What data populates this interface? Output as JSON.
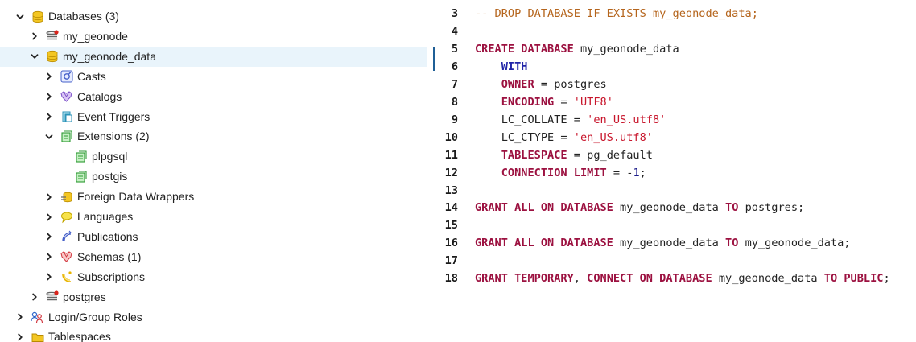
{
  "tree": {
    "items": [
      {
        "label": "Databases (3)",
        "chevron": "down",
        "icon": "database-icon",
        "level": 0
      },
      {
        "label": "my_geonode",
        "chevron": "right",
        "icon": "database-disconnected-icon",
        "level": 1
      },
      {
        "label": "my_geonode_data",
        "chevron": "down",
        "icon": "database-icon",
        "level": 1,
        "selected": true
      },
      {
        "label": "Casts",
        "chevron": "right",
        "icon": "casts-icon",
        "level": 2
      },
      {
        "label": "Catalogs",
        "chevron": "right",
        "icon": "catalogs-icon",
        "level": 2
      },
      {
        "label": "Event Triggers",
        "chevron": "right",
        "icon": "event-triggers-icon",
        "level": 2
      },
      {
        "label": "Extensions (2)",
        "chevron": "down",
        "icon": "extensions-icon",
        "level": 2
      },
      {
        "label": "plpgsql",
        "chevron": "none",
        "icon": "extension-icon",
        "level": 3
      },
      {
        "label": "postgis",
        "chevron": "none",
        "icon": "extension-icon",
        "level": 3
      },
      {
        "label": "Foreign Data Wrappers",
        "chevron": "right",
        "icon": "foreign-data-wrappers-icon",
        "level": 2
      },
      {
        "label": "Languages",
        "chevron": "right",
        "icon": "languages-icon",
        "level": 2
      },
      {
        "label": "Publications",
        "chevron": "right",
        "icon": "publications-icon",
        "level": 2
      },
      {
        "label": "Schemas (1)",
        "chevron": "right",
        "icon": "schemas-icon",
        "level": 2
      },
      {
        "label": "Subscriptions",
        "chevron": "right",
        "icon": "subscriptions-icon",
        "level": 2
      },
      {
        "label": "postgres",
        "chevron": "right",
        "icon": "database-disconnected-icon",
        "level": 1
      },
      {
        "label": "Login/Group Roles",
        "chevron": "right",
        "icon": "login-roles-icon",
        "level": 0
      },
      {
        "label": "Tablespaces",
        "chevron": "right",
        "icon": "tablespaces-icon",
        "level": 0
      }
    ]
  },
  "editor": {
    "lines": [
      {
        "num": "3",
        "tokens": [
          {
            "t": "-- DROP DATABASE IF EXISTS my_geonode_data;",
            "c": "cmt"
          }
        ]
      },
      {
        "num": "4",
        "tokens": []
      },
      {
        "num": "5",
        "tokens": [
          {
            "t": "CREATE DATABASE",
            "c": "kw"
          },
          {
            "t": " my_geonode_data",
            "c": "plain"
          }
        ]
      },
      {
        "num": "6",
        "tokens": [
          {
            "t": "    ",
            "c": "plain"
          },
          {
            "t": "WITH",
            "c": "kw2"
          }
        ]
      },
      {
        "num": "7",
        "tokens": [
          {
            "t": "    ",
            "c": "plain"
          },
          {
            "t": "OWNER",
            "c": "kw"
          },
          {
            "t": " = postgres",
            "c": "plain"
          }
        ]
      },
      {
        "num": "8",
        "tokens": [
          {
            "t": "    ",
            "c": "plain"
          },
          {
            "t": "ENCODING",
            "c": "kw"
          },
          {
            "t": " = ",
            "c": "plain"
          },
          {
            "t": "'UTF8'",
            "c": "str"
          }
        ]
      },
      {
        "num": "9",
        "tokens": [
          {
            "t": "    LC_COLLATE = ",
            "c": "plain"
          },
          {
            "t": "'en_US.utf8'",
            "c": "str"
          }
        ]
      },
      {
        "num": "10",
        "tokens": [
          {
            "t": "    LC_CTYPE = ",
            "c": "plain"
          },
          {
            "t": "'en_US.utf8'",
            "c": "str"
          }
        ]
      },
      {
        "num": "11",
        "tokens": [
          {
            "t": "    ",
            "c": "plain"
          },
          {
            "t": "TABLESPACE",
            "c": "kw"
          },
          {
            "t": " = pg_default",
            "c": "plain"
          }
        ]
      },
      {
        "num": "12",
        "tokens": [
          {
            "t": "    ",
            "c": "plain"
          },
          {
            "t": "CONNECTION LIMIT",
            "c": "kw"
          },
          {
            "t": " = -",
            "c": "plain"
          },
          {
            "t": "1",
            "c": "num"
          },
          {
            "t": ";",
            "c": "plain"
          }
        ]
      },
      {
        "num": "13",
        "tokens": []
      },
      {
        "num": "14",
        "tokens": [
          {
            "t": "GRANT ALL ON DATABASE",
            "c": "kw"
          },
          {
            "t": " my_geonode_data ",
            "c": "plain"
          },
          {
            "t": "TO",
            "c": "kw"
          },
          {
            "t": " postgres;",
            "c": "plain"
          }
        ]
      },
      {
        "num": "15",
        "tokens": []
      },
      {
        "num": "16",
        "tokens": [
          {
            "t": "GRANT ALL ON DATABASE",
            "c": "kw"
          },
          {
            "t": " my_geonode_data ",
            "c": "plain"
          },
          {
            "t": "TO",
            "c": "kw"
          },
          {
            "t": " my_geonode_data;",
            "c": "plain"
          }
        ]
      },
      {
        "num": "17",
        "tokens": []
      },
      {
        "num": "18",
        "tokens": [
          {
            "t": "GRANT TEMPORARY",
            "c": "kw"
          },
          {
            "t": ", ",
            "c": "plain"
          },
          {
            "t": "CONNECT ON DATABASE",
            "c": "kw"
          },
          {
            "t": " my_geonode_data ",
            "c": "plain"
          },
          {
            "t": "TO PUBLIC",
            "c": "kw"
          },
          {
            "t": ";",
            "c": "plain"
          }
        ]
      }
    ]
  },
  "colors": {
    "selected_row": "#e9f4fb",
    "keyword": "#9c1140",
    "keyword_alt": "#2125a8",
    "string": "#c8162c",
    "comment": "#b5651d",
    "active_line_marker": "#1f5f96"
  }
}
